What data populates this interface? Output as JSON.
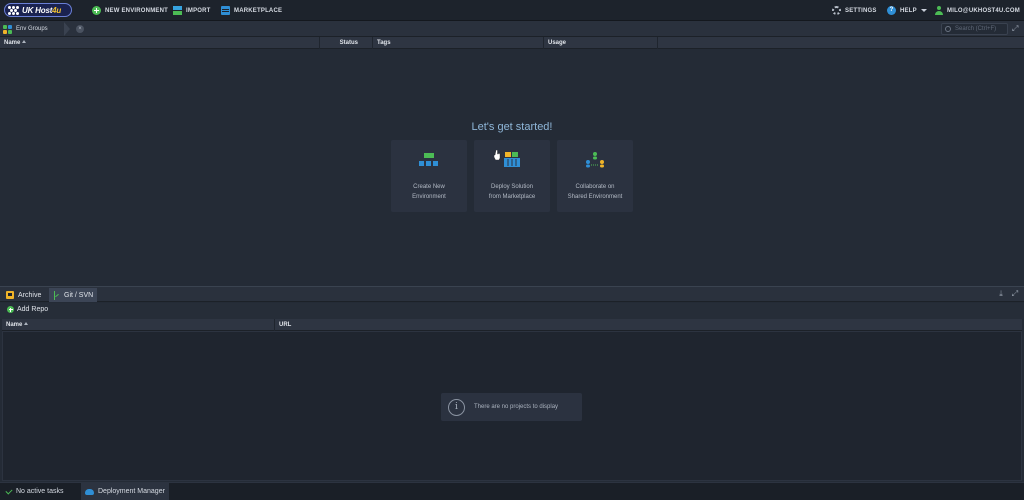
{
  "topbar": {
    "logo": {
      "text_main": "UK Host",
      "text_accent": "4u"
    },
    "new_environment": "NEW ENVIRONMENT",
    "import": "IMPORT",
    "marketplace": "MARKETPLACE",
    "settings": "SETTINGS",
    "help": "HELP",
    "user": "MILO@UKHOST4U.COM"
  },
  "envbar": {
    "env_groups": "Env Groups",
    "search_placeholder": "Search (Ctrl+F)"
  },
  "env_grid": {
    "columns": [
      "Name",
      "Status",
      "Tags",
      "Usage"
    ]
  },
  "empty_state": {
    "heading": "Let's get started!",
    "cards": [
      {
        "line1": "Create New",
        "line2": "Environment"
      },
      {
        "line1": "Deploy Solution",
        "line2": "from Marketplace"
      },
      {
        "line1": "Collaborate on",
        "line2": "Shared Environment"
      }
    ]
  },
  "bottom_panel": {
    "tabs": [
      "Archive",
      "Git / SVN"
    ],
    "active_tab": "Git / SVN",
    "add_repo": "Add Repo",
    "columns": [
      "Name",
      "URL"
    ],
    "empty_message": "There are no projects to display"
  },
  "statusbar": {
    "tasks": "No active tasks",
    "deployment_manager": "Deployment Manager"
  },
  "colors": {
    "accent_green": "#4cbc55",
    "accent_blue": "#2f8fd6",
    "accent_yellow": "#f0b429",
    "heading_blue": "#8fb6d8"
  }
}
